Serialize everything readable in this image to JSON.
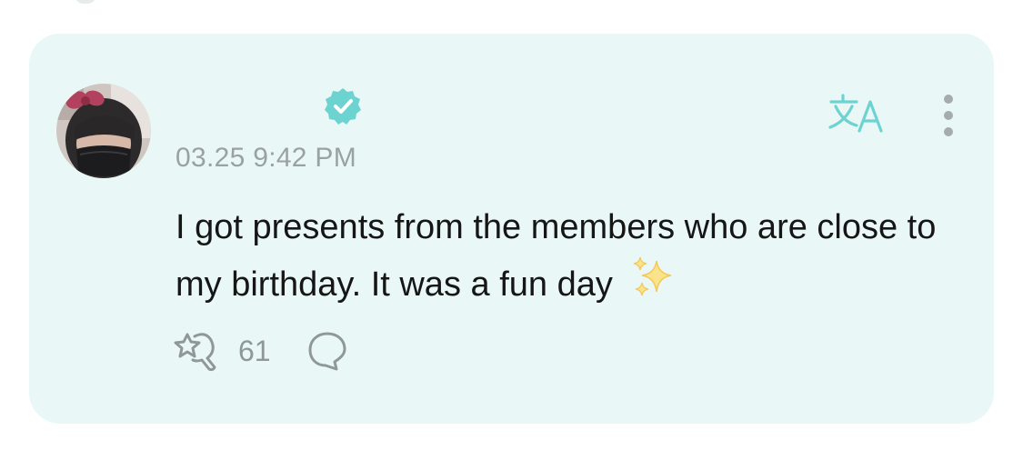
{
  "post": {
    "timestamp": "03.25 9:42 PM",
    "text": "I got presents from the members who are close to my birthday. It was a fun day",
    "emoji": "sparkles",
    "like_count": "61",
    "verified": true
  },
  "icons": {
    "verified": "verified-badge-icon",
    "translate": "translate-icon",
    "more": "more-vertical-icon",
    "like": "like-icon",
    "comment": "comment-icon"
  },
  "colors": {
    "card_background": "#e9f8f6",
    "accent": "#6dd3d1",
    "muted_text": "#9aa1a3",
    "body_text": "#161616",
    "sparkle": "#f7d36a"
  }
}
